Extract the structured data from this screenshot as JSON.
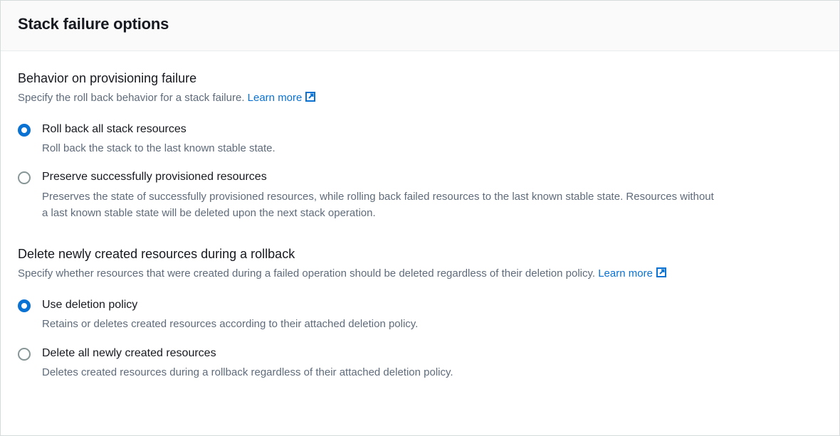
{
  "panel": {
    "title": "Stack failure options"
  },
  "section1": {
    "heading": "Behavior on provisioning failure",
    "description": "Specify the roll back behavior for a stack failure. ",
    "learnMore": "Learn more",
    "options": [
      {
        "label": "Roll back all stack resources",
        "description": "Roll back the stack to the last known stable state.",
        "selected": true
      },
      {
        "label": "Preserve successfully provisioned resources",
        "description": "Preserves the state of successfully provisioned resources, while rolling back failed resources to the last known stable state. Resources without a last known stable state will be deleted upon the next stack operation.",
        "selected": false
      }
    ]
  },
  "section2": {
    "heading": "Delete newly created resources during a rollback",
    "description": "Specify whether resources that were created during a failed operation should be deleted regardless of their deletion policy. ",
    "learnMore": "Learn more",
    "options": [
      {
        "label": "Use deletion policy",
        "description": "Retains or deletes created resources according to their attached deletion policy.",
        "selected": true
      },
      {
        "label": "Delete all newly created resources",
        "description": "Deletes created resources during a rollback regardless of their attached deletion policy.",
        "selected": false
      }
    ]
  }
}
